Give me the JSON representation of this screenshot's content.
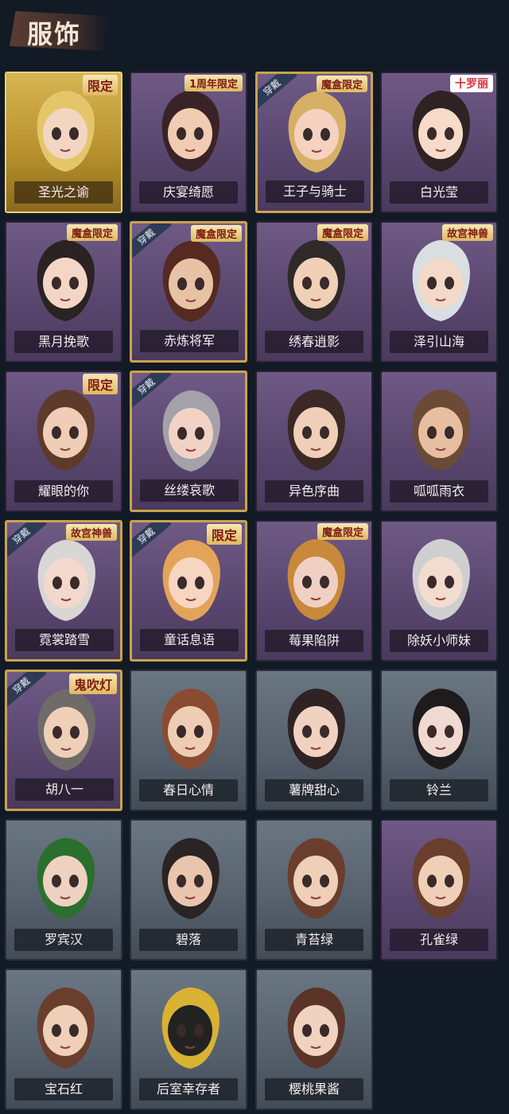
{
  "header": {
    "title": "服饰"
  },
  "cards": [
    {
      "name": "圣光之谕",
      "style": "gold",
      "badge": "限定",
      "equipped": false,
      "hair": "#e5c56a",
      "skin": "#f2d6c2"
    },
    {
      "name": "庆宴绮愿",
      "style": "purple",
      "badge": "1周年限定",
      "equipped": false,
      "hair": "#3a2326",
      "skin": "#f1cbb2"
    },
    {
      "name": "王子与骑士",
      "style": "purple",
      "badge": "魔盒限定",
      "equipped": true,
      "hair": "#d7b066",
      "skin": "#f4d2bf"
    },
    {
      "name": "白光莹",
      "style": "purple",
      "badge": "十罗丽",
      "equipped": false,
      "hair": "#2f2222",
      "skin": "#f6dbc8"
    },
    {
      "name": "黑月挽歌",
      "style": "purple",
      "badge": "魔盒限定",
      "equipped": false,
      "hair": "#2b2222",
      "skin": "#f4d6c6"
    },
    {
      "name": "赤炼将军",
      "style": "purple",
      "badge": "魔盒限定",
      "equipped": true,
      "hair": "#562921",
      "skin": "#e7c2a5"
    },
    {
      "name": "绣春逍影",
      "style": "purple",
      "badge": "魔盒限定",
      "equipped": false,
      "hair": "#2f2a29",
      "skin": "#f0d0b7"
    },
    {
      "name": "泽引山海",
      "style": "purple",
      "badge": "故宫神兽",
      "equipped": false,
      "hair": "#d8dee2",
      "skin": "#f3d9c7"
    },
    {
      "name": "耀眼的你",
      "style": "purple",
      "badge": "限定",
      "equipped": false,
      "hair": "#5e3a2b",
      "skin": "#f0cdb7"
    },
    {
      "name": "丝缕哀歌",
      "style": "purple",
      "badge": "",
      "equipped": true,
      "hair": "#a3a1aa",
      "skin": "#f3d2c6"
    },
    {
      "name": "异色序曲",
      "style": "purple",
      "badge": "",
      "equipped": false,
      "hair": "#3b2925",
      "skin": "#f0cfb9"
    },
    {
      "name": "呱呱雨衣",
      "style": "purple",
      "badge": "",
      "equipped": false,
      "hair": "#6b4a36",
      "skin": "#e8bea0"
    },
    {
      "name": "霓裳踏雪",
      "style": "purple",
      "badge": "故宫神兽",
      "equipped": true,
      "hair": "#d9d6d6",
      "skin": "#f3d8cd"
    },
    {
      "name": "童话息语",
      "style": "purple",
      "badge": "限定",
      "equipped": true,
      "hair": "#e3a45a",
      "skin": "#f6d5c1"
    },
    {
      "name": "莓果陷阱",
      "style": "purple",
      "badge": "魔盒限定",
      "equipped": false,
      "hair": "#c9893a",
      "skin": "#f0d0c3"
    },
    {
      "name": "除妖小师妹",
      "style": "purple",
      "badge": "",
      "equipped": false,
      "hair": "#cfcfd0",
      "skin": "#f2dbcf"
    },
    {
      "name": "胡八一",
      "style": "purple",
      "badge": "鬼吹灯",
      "equipped": true,
      "hair": "#6f6b69",
      "skin": "#efcfb8"
    },
    {
      "name": "春日心情",
      "style": "gray",
      "badge": "",
      "equipped": false,
      "hair": "#8a4b33",
      "skin": "#efcdb5"
    },
    {
      "name": "薯牌甜心",
      "style": "gray",
      "badge": "",
      "equipped": false,
      "hair": "#2e2223",
      "skin": "#f1d1c0"
    },
    {
      "name": "铃兰",
      "style": "gray",
      "badge": "",
      "equipped": false,
      "hair": "#1f1b1d",
      "skin": "#f0d9d0"
    },
    {
      "name": "罗宾汉",
      "style": "gray",
      "badge": "",
      "equipped": false,
      "hair": "#2b6f2e",
      "skin": "#efd1c1"
    },
    {
      "name": "碧落",
      "style": "gray",
      "badge": "",
      "equipped": false,
      "hair": "#2a2424",
      "skin": "#e9c5ad"
    },
    {
      "name": "青苔绿",
      "style": "gray",
      "badge": "",
      "equipped": false,
      "hair": "#6a3e2d",
      "skin": "#efcfb7"
    },
    {
      "name": "孔雀绿",
      "style": "purple",
      "badge": "",
      "equipped": false,
      "hair": "#6a3e2d",
      "skin": "#efcfb7"
    },
    {
      "name": "宝石红",
      "style": "gray",
      "badge": "",
      "equipped": false,
      "hair": "#6a3e2d",
      "skin": "#efcfb7"
    },
    {
      "name": "后室幸存者",
      "style": "gray",
      "badge": "",
      "equipped": false,
      "hair": "#d9b233",
      "skin": "#222222"
    },
    {
      "name": "樱桃果酱",
      "style": "gray",
      "badge": "",
      "equipped": false,
      "hair": "#5a3426",
      "skin": "#f0d2c0"
    }
  ],
  "equip_label": "穿戴"
}
